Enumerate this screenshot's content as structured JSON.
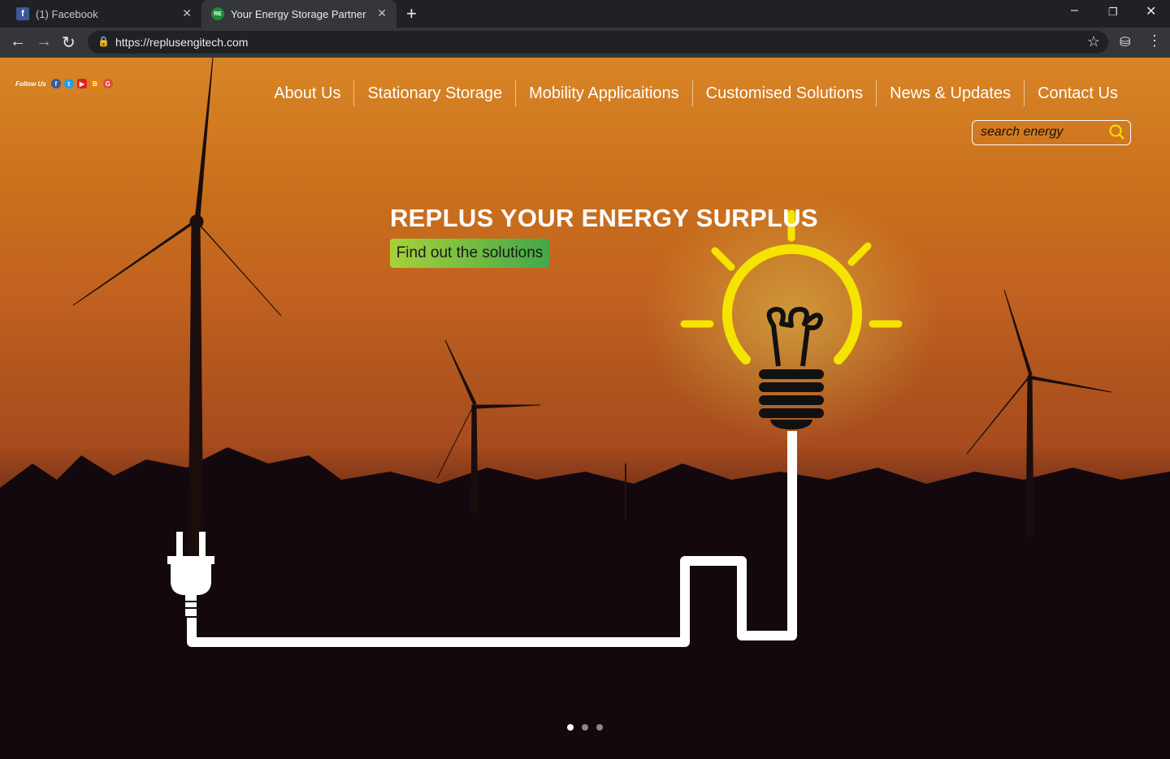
{
  "browser": {
    "tabs": [
      {
        "label": "(1) Facebook",
        "icon": "facebook-icon"
      },
      {
        "label": "Your Energy Storage Partner",
        "icon": "site-icon"
      }
    ],
    "url": "https://replusengitech.com"
  },
  "site": {
    "follow_label": "Follow Us",
    "social": [
      "facebook-icon",
      "twitter-icon",
      "youtube-icon",
      "blogger-icon",
      "google-plus-icon"
    ],
    "nav": [
      "About Us",
      "Stationary Storage",
      "Mobility Applicaitions",
      "Customised Solutions",
      "News & Updates",
      "Contact Us"
    ],
    "search_placeholder": "search energy",
    "headline": "REPLUS YOUR ENERGY SURPLUS",
    "cta": "Find out the solutions",
    "carousel_active": 1,
    "carousel_count": 3
  },
  "colors": {
    "accent": "#f5e400",
    "cta_start": "#a8d13a",
    "cta_end": "#42a84a"
  }
}
